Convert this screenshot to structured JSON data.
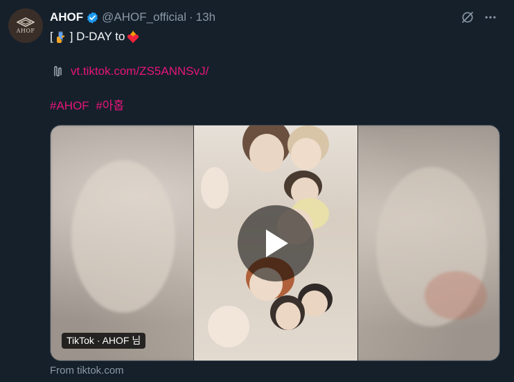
{
  "tweet": {
    "display_name": "AHOF",
    "handle": "@AHOF_official",
    "separator": "·",
    "time": "13h",
    "avatar_text": "AHOF",
    "text_open": "[",
    "text_close": "] D-DAY to",
    "link": "vt.tiktok.com/ZS5ANNSvJ/",
    "hashtags": [
      "#AHOF",
      "#아홉"
    ]
  },
  "media": {
    "caption": "TikTok · AHOF 님",
    "source": "From tiktok.com"
  },
  "icons": {
    "verified": "verified-badge-icon",
    "grok": "grok-icon",
    "more": "more-icon",
    "paperclip": "paperclip-icon",
    "play": "play-icon"
  },
  "colors": {
    "background": "#15202b",
    "link": "#e8157a",
    "verified": "#1d9bf0",
    "muted": "#8b98a5"
  }
}
